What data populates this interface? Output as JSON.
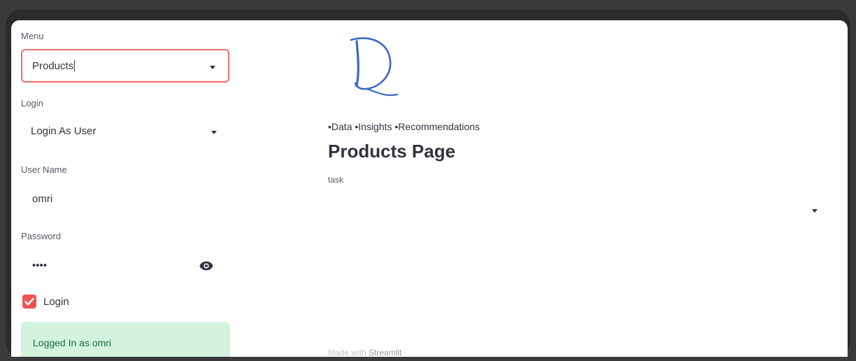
{
  "sidebar": {
    "menu_label": "Menu",
    "menu_value": "Products",
    "login_label": "Login",
    "login_value": "Login As User",
    "username_label": "User Name",
    "username_value": "omri",
    "password_label": "Password",
    "password_value": "••••",
    "password_toggle_icon": "eye-icon",
    "checkbox_label": "Login",
    "checkbox_checked": true,
    "status_message": "Logged In as omri"
  },
  "main": {
    "tagline": "•Data •Insights •Recommendations",
    "title": "Products Page",
    "task_label": "task",
    "task_value": "",
    "footer_prefix": "Made with ",
    "footer_brand": "Streamlit"
  },
  "colors": {
    "accent": "#f36d6d",
    "checkbox": "#f05252",
    "success_bg": "#d3f3df",
    "success_text": "#1e6b3a",
    "logo": "#3a67c9"
  }
}
